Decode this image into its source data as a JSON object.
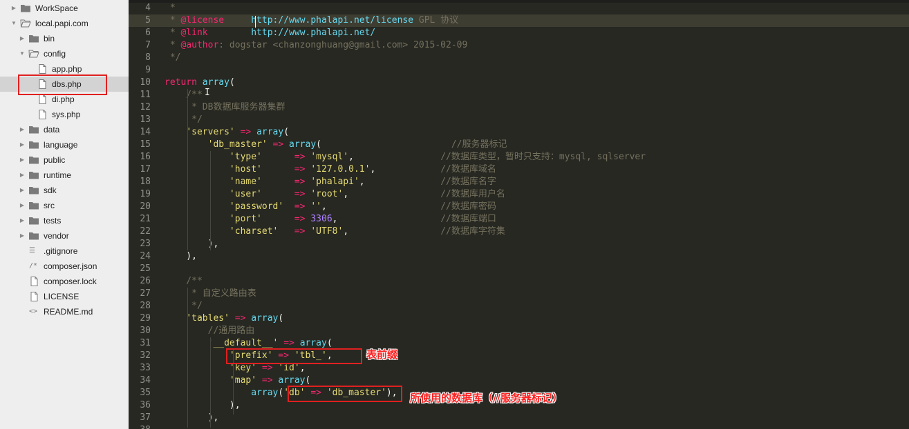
{
  "sidebar": {
    "items": [
      {
        "label": "WorkSpace",
        "type": "folder",
        "expanded": false,
        "depth": 0
      },
      {
        "label": "local.papi.com",
        "type": "folder",
        "expanded": true,
        "depth": 0
      },
      {
        "label": "bin",
        "type": "folder",
        "expanded": false,
        "depth": 1
      },
      {
        "label": "config",
        "type": "folder",
        "expanded": true,
        "depth": 1
      },
      {
        "label": "app.php",
        "type": "file",
        "depth": 2
      },
      {
        "label": "dbs.php",
        "type": "file",
        "depth": 2,
        "selected": true
      },
      {
        "label": "di.php",
        "type": "file",
        "depth": 2
      },
      {
        "label": "sys.php",
        "type": "file",
        "depth": 2
      },
      {
        "label": "data",
        "type": "folder",
        "expanded": false,
        "depth": 1
      },
      {
        "label": "language",
        "type": "folder",
        "expanded": false,
        "depth": 1
      },
      {
        "label": "public",
        "type": "folder",
        "expanded": false,
        "depth": 1
      },
      {
        "label": "runtime",
        "type": "folder",
        "expanded": false,
        "depth": 1
      },
      {
        "label": "sdk",
        "type": "folder",
        "expanded": false,
        "depth": 1
      },
      {
        "label": "src",
        "type": "folder",
        "expanded": false,
        "depth": 1
      },
      {
        "label": "tests",
        "type": "folder",
        "expanded": false,
        "depth": 1
      },
      {
        "label": "vendor",
        "type": "folder",
        "expanded": false,
        "depth": 1
      },
      {
        "label": ".gitignore",
        "type": "lines",
        "depth": 1
      },
      {
        "label": "composer.json",
        "type": "json",
        "depth": 1
      },
      {
        "label": "composer.lock",
        "type": "file",
        "depth": 1
      },
      {
        "label": "LICENSE",
        "type": "file",
        "depth": 1
      },
      {
        "label": "README.md",
        "type": "markup",
        "depth": 1
      }
    ]
  },
  "editor": {
    "lines": [
      {
        "n": "4",
        "tokens": [
          [
            "c-com",
            " *"
          ]
        ]
      },
      {
        "n": "5",
        "current": true,
        "tokens": [
          [
            "c-com",
            " * "
          ],
          [
            "c-at",
            "@license"
          ],
          [
            "c-com",
            "     "
          ],
          [
            "c-url",
            "http://www.phalapi.net/license"
          ],
          [
            "c-com",
            " GPL 协议"
          ]
        ]
      },
      {
        "n": "6",
        "tokens": [
          [
            "c-com",
            " * "
          ],
          [
            "c-at",
            "@link"
          ],
          [
            "c-com",
            "        "
          ],
          [
            "c-url",
            "http://www.phalapi.net/"
          ]
        ]
      },
      {
        "n": "7",
        "tokens": [
          [
            "c-com",
            " * "
          ],
          [
            "c-at",
            "@author"
          ],
          [
            "c-com",
            ": dogstar <chanzonghuang@gmail.com> 2015-02-09"
          ]
        ]
      },
      {
        "n": "8",
        "tokens": [
          [
            "c-com",
            " */"
          ]
        ]
      },
      {
        "n": "9",
        "tokens": []
      },
      {
        "n": "10",
        "tokens": [
          [
            "c-kw",
            "return"
          ],
          [
            "c-txt",
            " "
          ],
          [
            "c-fn",
            "array"
          ],
          [
            "c-txt",
            "("
          ]
        ]
      },
      {
        "n": "11",
        "tokens": [
          [
            "c-com",
            "    /**"
          ]
        ]
      },
      {
        "n": "12",
        "tokens": [
          [
            "c-com",
            "     * DB数据库服务器集群"
          ]
        ]
      },
      {
        "n": "13",
        "tokens": [
          [
            "c-com",
            "     */"
          ]
        ]
      },
      {
        "n": "14",
        "tokens": [
          [
            "c-txt",
            "    "
          ],
          [
            "c-str",
            "'servers'"
          ],
          [
            "c-txt",
            " "
          ],
          [
            "c-kw",
            "=>"
          ],
          [
            "c-txt",
            " "
          ],
          [
            "c-fn",
            "array"
          ],
          [
            "c-txt",
            "("
          ]
        ]
      },
      {
        "n": "15",
        "tokens": [
          [
            "c-txt",
            "        "
          ],
          [
            "c-str",
            "'db_master'"
          ],
          [
            "c-txt",
            " "
          ],
          [
            "c-kw",
            "=>"
          ],
          [
            "c-txt",
            " "
          ],
          [
            "c-fn",
            "array"
          ],
          [
            "c-txt",
            "(                        "
          ],
          [
            "c-com",
            "//服务器标记"
          ]
        ]
      },
      {
        "n": "16",
        "tokens": [
          [
            "c-txt",
            "            "
          ],
          [
            "c-str",
            "'type'"
          ],
          [
            "c-txt",
            "      "
          ],
          [
            "c-kw",
            "=>"
          ],
          [
            "c-txt",
            " "
          ],
          [
            "c-str",
            "'mysql'"
          ],
          [
            "c-txt",
            ",                "
          ],
          [
            "c-com",
            "//数据库类型，暂时只支持：mysql, sqlserver"
          ]
        ]
      },
      {
        "n": "17",
        "tokens": [
          [
            "c-txt",
            "            "
          ],
          [
            "c-str",
            "'host'"
          ],
          [
            "c-txt",
            "      "
          ],
          [
            "c-kw",
            "=>"
          ],
          [
            "c-txt",
            " "
          ],
          [
            "c-str",
            "'127.0.0.1'"
          ],
          [
            "c-txt",
            ",            "
          ],
          [
            "c-com",
            "//数据库域名"
          ]
        ]
      },
      {
        "n": "18",
        "tokens": [
          [
            "c-txt",
            "            "
          ],
          [
            "c-str",
            "'name'"
          ],
          [
            "c-txt",
            "      "
          ],
          [
            "c-kw",
            "=>"
          ],
          [
            "c-txt",
            " "
          ],
          [
            "c-str",
            "'phalapi'"
          ],
          [
            "c-txt",
            ",              "
          ],
          [
            "c-com",
            "//数据库名字"
          ]
        ]
      },
      {
        "n": "19",
        "tokens": [
          [
            "c-txt",
            "            "
          ],
          [
            "c-str",
            "'user'"
          ],
          [
            "c-txt",
            "      "
          ],
          [
            "c-kw",
            "=>"
          ],
          [
            "c-txt",
            " "
          ],
          [
            "c-str",
            "'root'"
          ],
          [
            "c-txt",
            ",                 "
          ],
          [
            "c-com",
            "//数据库用户名"
          ]
        ]
      },
      {
        "n": "20",
        "tokens": [
          [
            "c-txt",
            "            "
          ],
          [
            "c-str",
            "'password'"
          ],
          [
            "c-txt",
            "  "
          ],
          [
            "c-kw",
            "=>"
          ],
          [
            "c-txt",
            " "
          ],
          [
            "c-str",
            "''"
          ],
          [
            "c-txt",
            ",                     "
          ],
          [
            "c-com",
            "//数据库密码"
          ]
        ]
      },
      {
        "n": "21",
        "tokens": [
          [
            "c-txt",
            "            "
          ],
          [
            "c-str",
            "'port'"
          ],
          [
            "c-txt",
            "      "
          ],
          [
            "c-kw",
            "=>"
          ],
          [
            "c-txt",
            " "
          ],
          [
            "c-num",
            "3306"
          ],
          [
            "c-txt",
            ",                   "
          ],
          [
            "c-com",
            "//数据库端口"
          ]
        ]
      },
      {
        "n": "22",
        "tokens": [
          [
            "c-txt",
            "            "
          ],
          [
            "c-str",
            "'charset'"
          ],
          [
            "c-txt",
            "   "
          ],
          [
            "c-kw",
            "=>"
          ],
          [
            "c-txt",
            " "
          ],
          [
            "c-str",
            "'UTF8'"
          ],
          [
            "c-txt",
            ",                 "
          ],
          [
            "c-com",
            "//数据库字符集"
          ]
        ]
      },
      {
        "n": "23",
        "tokens": [
          [
            "c-txt",
            "        ),"
          ]
        ]
      },
      {
        "n": "24",
        "tokens": [
          [
            "c-txt",
            "    ),"
          ]
        ]
      },
      {
        "n": "25",
        "tokens": []
      },
      {
        "n": "26",
        "tokens": [
          [
            "c-com",
            "    /**"
          ]
        ]
      },
      {
        "n": "27",
        "tokens": [
          [
            "c-com",
            "     * 自定义路由表"
          ]
        ]
      },
      {
        "n": "28",
        "tokens": [
          [
            "c-com",
            "     */"
          ]
        ]
      },
      {
        "n": "29",
        "tokens": [
          [
            "c-txt",
            "    "
          ],
          [
            "c-str",
            "'tables'"
          ],
          [
            "c-txt",
            " "
          ],
          [
            "c-kw",
            "=>"
          ],
          [
            "c-txt",
            " "
          ],
          [
            "c-fn",
            "array"
          ],
          [
            "c-txt",
            "("
          ]
        ]
      },
      {
        "n": "30",
        "tokens": [
          [
            "c-com",
            "        //通用路由"
          ]
        ]
      },
      {
        "n": "31",
        "tokens": [
          [
            "c-txt",
            "        "
          ],
          [
            "c-str",
            "'__default__'"
          ],
          [
            "c-txt",
            " "
          ],
          [
            "c-kw",
            "=>"
          ],
          [
            "c-txt",
            " "
          ],
          [
            "c-fn",
            "array"
          ],
          [
            "c-txt",
            "("
          ]
        ]
      },
      {
        "n": "32",
        "tokens": [
          [
            "c-txt",
            "            "
          ],
          [
            "c-str",
            "'prefix'"
          ],
          [
            "c-txt",
            " "
          ],
          [
            "c-kw",
            "=>"
          ],
          [
            "c-txt",
            " "
          ],
          [
            "c-str",
            "'tbl_'"
          ],
          [
            "c-txt",
            ","
          ]
        ]
      },
      {
        "n": "33",
        "tokens": [
          [
            "c-txt",
            "            "
          ],
          [
            "c-str",
            "'key'"
          ],
          [
            "c-txt",
            " "
          ],
          [
            "c-kw",
            "=>"
          ],
          [
            "c-txt",
            " "
          ],
          [
            "c-str",
            "'id'"
          ],
          [
            "c-txt",
            ","
          ]
        ]
      },
      {
        "n": "34",
        "tokens": [
          [
            "c-txt",
            "            "
          ],
          [
            "c-str",
            "'map'"
          ],
          [
            "c-txt",
            " "
          ],
          [
            "c-kw",
            "=>"
          ],
          [
            "c-txt",
            " "
          ],
          [
            "c-fn",
            "array"
          ],
          [
            "c-txt",
            "("
          ]
        ]
      },
      {
        "n": "35",
        "tokens": [
          [
            "c-txt",
            "                "
          ],
          [
            "c-fn",
            "array"
          ],
          [
            "c-txt",
            "("
          ],
          [
            "c-str",
            "'db'"
          ],
          [
            "c-txt",
            " "
          ],
          [
            "c-kw",
            "=>"
          ],
          [
            "c-txt",
            " "
          ],
          [
            "c-str",
            "'db_master'"
          ],
          [
            "c-txt",
            "),"
          ]
        ]
      },
      {
        "n": "36",
        "tokens": [
          [
            "c-txt",
            "            ),"
          ]
        ]
      },
      {
        "n": "37",
        "tokens": [
          [
            "c-txt",
            "        ),"
          ]
        ]
      },
      {
        "n": "38",
        "tokens": []
      }
    ]
  },
  "annotations": {
    "prefix_note": "表前缀",
    "db_note": "所使用的数据库（//服务器标记）"
  }
}
